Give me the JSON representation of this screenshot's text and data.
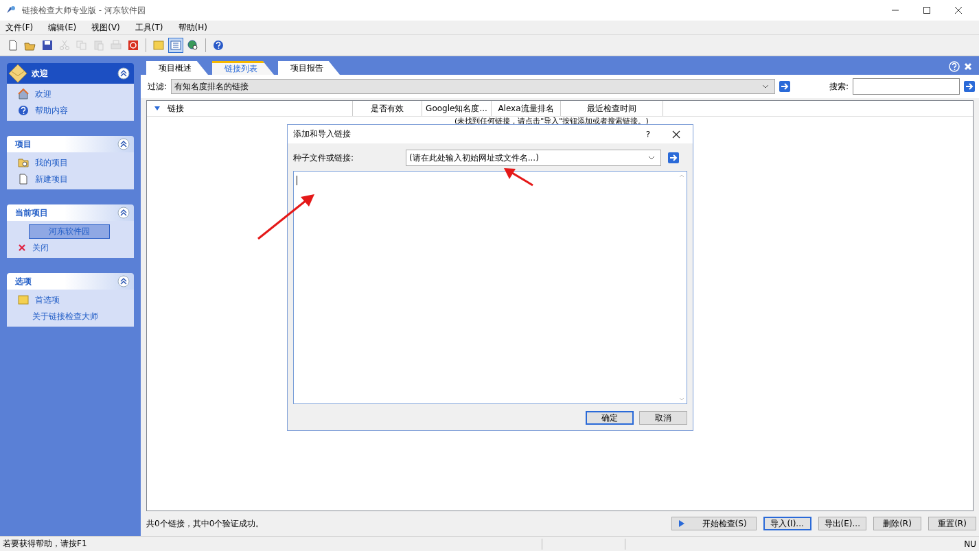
{
  "window": {
    "title": "链接检查大师专业版 - 河东软件园"
  },
  "menu": [
    "文件(F)",
    "编辑(E)",
    "视图(V)",
    "工具(T)",
    "帮助(H)"
  ],
  "toolbar": [
    [
      {
        "kind": "new",
        "disabled": false,
        "selected": false
      },
      {
        "kind": "open",
        "disabled": false,
        "selected": false
      },
      {
        "kind": "save",
        "disabled": false,
        "selected": false
      },
      {
        "kind": "cut",
        "disabled": true,
        "selected": false
      },
      {
        "kind": "copy",
        "disabled": true,
        "selected": false
      },
      {
        "kind": "paste",
        "disabled": true,
        "selected": false
      },
      {
        "kind": "print",
        "disabled": true,
        "selected": false
      },
      {
        "kind": "stop",
        "disabled": false,
        "selected": false
      }
    ],
    [
      {
        "kind": "note",
        "disabled": false,
        "selected": false
      },
      {
        "kind": "list",
        "disabled": false,
        "selected": true
      },
      {
        "kind": "globe",
        "disabled": false,
        "selected": false
      }
    ],
    [
      {
        "kind": "help",
        "disabled": false,
        "selected": false
      }
    ]
  ],
  "sidebar": {
    "panels": [
      {
        "title": "欢迎",
        "kind": "primary",
        "expanded": true,
        "items": [
          {
            "label": "欢迎",
            "kind": "home",
            "selected": false
          },
          {
            "label": "帮助内容",
            "kind": "help",
            "selected": false
          }
        ]
      },
      {
        "title": "项目",
        "kind": "normal",
        "expanded": true,
        "items": [
          {
            "label": "我的项目",
            "kind": "folder",
            "selected": false
          },
          {
            "label": "新建项目",
            "kind": "page",
            "selected": false
          }
        ]
      },
      {
        "title": "当前项目",
        "kind": "normal",
        "expanded": true,
        "items": [
          {
            "label": "河东软件园",
            "kind": "plain",
            "selected": true
          },
          {
            "label": "关闭",
            "kind": "close",
            "selected": false
          }
        ]
      },
      {
        "title": "选项",
        "kind": "normal",
        "expanded": true,
        "items": [
          {
            "label": "首选项",
            "kind": "note",
            "selected": false
          },
          {
            "label": "关于链接检查大师",
            "kind": "plain",
            "selected": false
          }
        ]
      }
    ]
  },
  "tabs": [
    {
      "label": "项目概述",
      "selected": false
    },
    {
      "label": "链接列表",
      "selected": true
    },
    {
      "label": "项目报告",
      "selected": false
    }
  ],
  "filter": {
    "label": "过滤:",
    "value": "有知名度排名的链接"
  },
  "search": {
    "label": "搜索:"
  },
  "table": {
    "columns": [
      "链接",
      "是否有效",
      "Google知名度...",
      "Alexa流量排名",
      "最近检查时间"
    ],
    "empty_message": "(未找到任何链接，请点击\"导入\"按钮添加或者搜索链接。)"
  },
  "summary": "共0个链接，其中0个验证成功。",
  "buttons": [
    {
      "label": "开始检查(S)",
      "kind": "play",
      "default": false
    },
    {
      "label": "导入(I)...",
      "kind": "plain",
      "default": true
    },
    {
      "label": "导出(E)...",
      "kind": "plain",
      "default": false
    },
    {
      "label": "删除(R)",
      "kind": "plain",
      "default": false
    },
    {
      "label": "重置(R)",
      "kind": "plain",
      "default": false
    }
  ],
  "dialog": {
    "title": "添加和导入链接",
    "help": "?",
    "field_label": "种子文件或链接:",
    "placeholder": "(请在此处输入初始网址或文件名...)",
    "buttons": [
      {
        "label": "确定",
        "default": true
      },
      {
        "label": "取消",
        "default": false
      }
    ]
  },
  "status_bar": {
    "help": "若要获得帮助，请按F1",
    "indicator": "NU"
  }
}
